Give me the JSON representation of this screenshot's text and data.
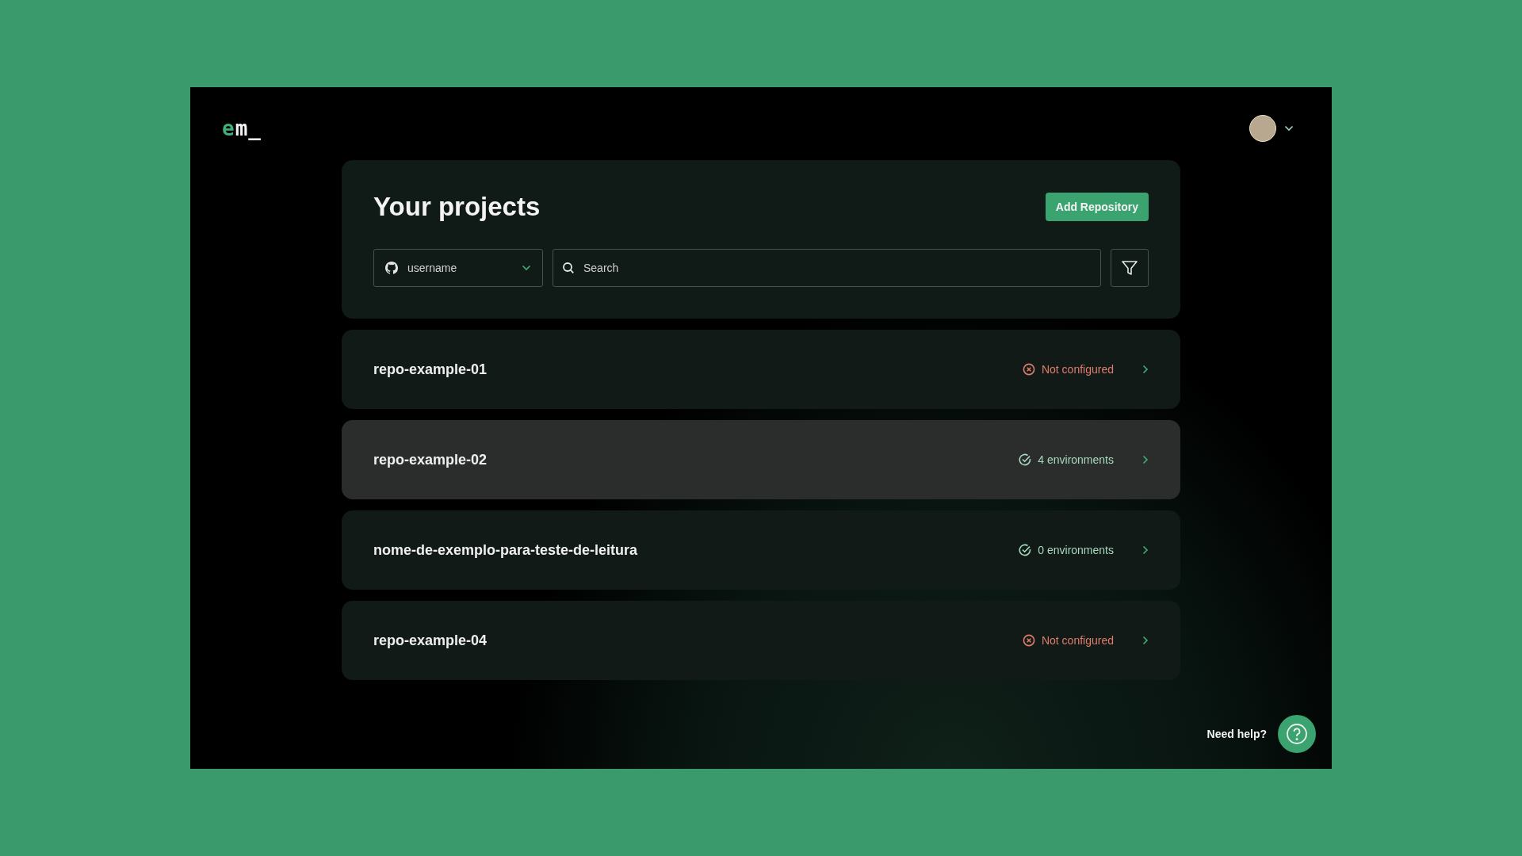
{
  "logo": {
    "accent": "e",
    "rest": "m_"
  },
  "header": {
    "title": "Your projects",
    "add_button": "Add Repository",
    "account_select": {
      "value": "username"
    },
    "search": {
      "placeholder": "Search"
    }
  },
  "repositories": [
    {
      "name": "repo-example-01",
      "status": {
        "kind": "error",
        "text": "Not configured"
      },
      "hovered": false
    },
    {
      "name": "repo-example-02",
      "status": {
        "kind": "ok",
        "text": "4 environments"
      },
      "hovered": true
    },
    {
      "name": "nome-de-exemplo-para-teste-de-leitura",
      "status": {
        "kind": "ok",
        "text": "0 environments"
      },
      "hovered": false
    },
    {
      "name": "repo-example-04",
      "status": {
        "kind": "error",
        "text": "Not configured"
      },
      "hovered": false
    }
  ],
  "help": {
    "label": "Need help?"
  }
}
